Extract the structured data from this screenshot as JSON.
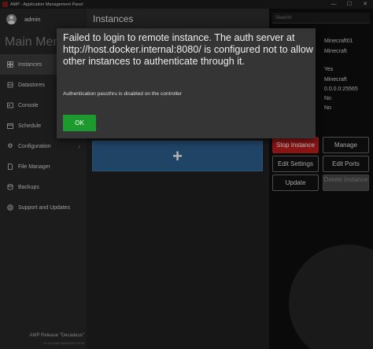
{
  "window": {
    "title": "AMP - Application Management Panel",
    "buttons": [
      "—",
      "☐",
      "✕"
    ]
  },
  "sidebar": {
    "username": "admin",
    "main_menu": "Main Menu",
    "items": [
      {
        "label": "Instances",
        "icon": "instances-icon",
        "active": true
      },
      {
        "label": "Datastores",
        "icon": "datastores-icon"
      },
      {
        "label": "Console",
        "icon": "console-icon"
      },
      {
        "label": "Schedule",
        "icon": "schedule-icon"
      },
      {
        "label": "Configuration",
        "icon": "configuration-icon"
      },
      {
        "label": "File Manager",
        "icon": "file-manager-icon"
      },
      {
        "label": "Backups",
        "icon": "backups-icon"
      },
      {
        "label": "Support and Updates",
        "icon": "support-icon"
      }
    ],
    "release": "AMP Release \"Decadeus\"",
    "build": "v2.4.6 built 19/06/2023 12:49"
  },
  "main": {
    "header": "Instances",
    "add_symbol": "+"
  },
  "right_panel": {
    "search_placeholder": "Search",
    "info": {
      "name": "Minecraft01",
      "module": "Minecraft",
      "running": "Yes",
      "type": "Minecraft",
      "endpoint": "0.0.0.0:25565",
      "flag1": "No",
      "flag2": "No"
    },
    "buttons": {
      "stop": "Stop Instance",
      "manage": "Manage",
      "edit_settings": "Edit Settings",
      "edit_ports": "Edit Ports",
      "update": "Update",
      "delete": "Delete Instance"
    }
  },
  "dialog": {
    "title": "Failed to login to remote instance. The auth server at http://host.docker.internal:8080/ is configured not to allow other instances to authenticate through it.",
    "message": "Authentication passthru is disabled on the controller",
    "ok_label": "OK"
  },
  "colors": {
    "accent_green": "#1d9a2e",
    "stop_red": "#b81d1d",
    "tile_blue": "#2b5b87"
  }
}
